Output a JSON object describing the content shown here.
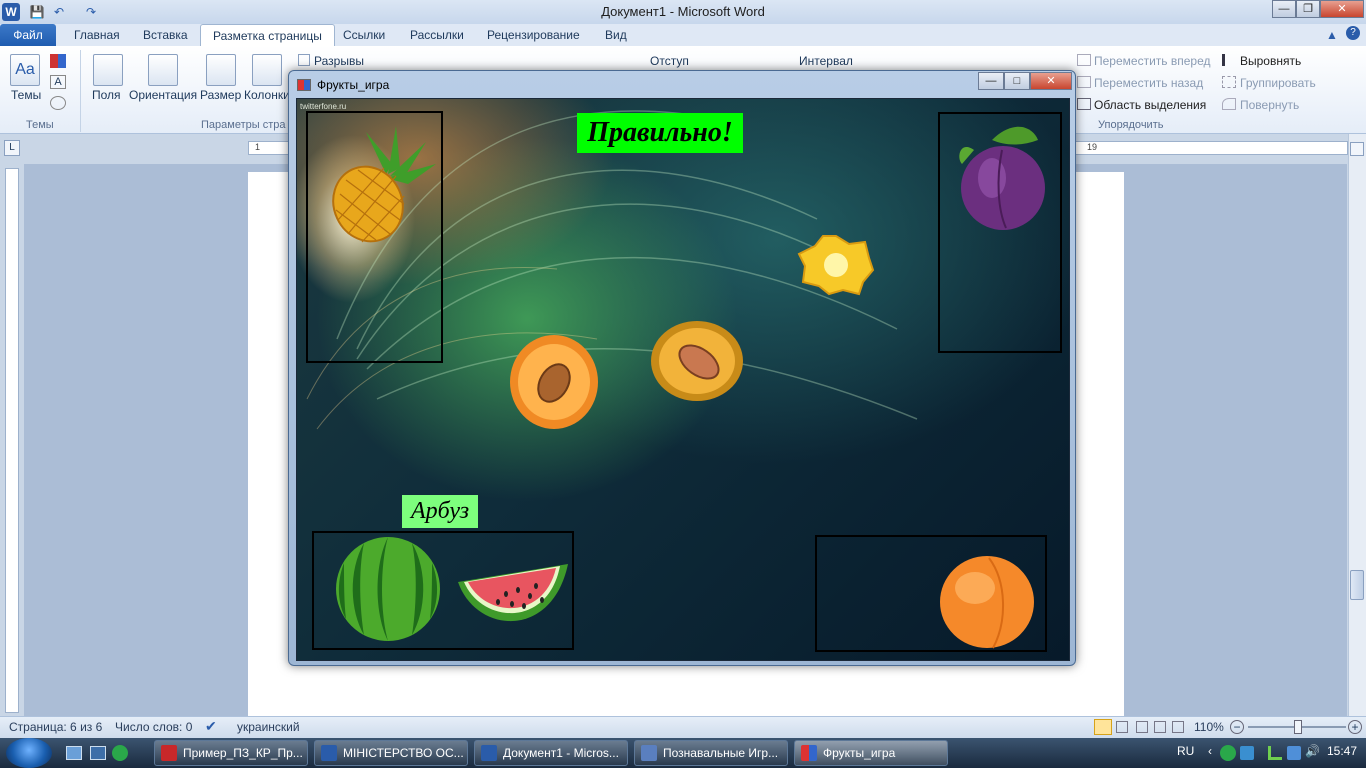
{
  "window": {
    "title": "Документ1  -  Microsoft Word"
  },
  "ribbon": {
    "file_tab": "Файл",
    "tabs": [
      "Главная",
      "Вставка",
      "Разметка страницы",
      "Ссылки",
      "Рассылки",
      "Рецензирование",
      "Вид"
    ],
    "active_tab": "Разметка страницы",
    "themes_label": "Темы",
    "themes_group": "Темы",
    "fields_label": "Поля",
    "orientation_label": "Ориентация",
    "size_label": "Размер",
    "columns_label": "Колонки",
    "breaks_label": "Разрывы",
    "page_setup_group": "Параметры стра",
    "indent_label": "Отступ",
    "spacing_label": "Интервал",
    "bring_forward": "Переместить вперед",
    "send_backward": "Переместить назад",
    "selection_pane": "Область выделения",
    "align": "Выровнять",
    "group": "Группировать",
    "rotate": "Повернуть",
    "arrange_group": "Упорядочить"
  },
  "ruler": {
    "h_marks": [
      "1",
      "19"
    ]
  },
  "game": {
    "title": "Фрукты_игра",
    "watermark": "twitterfone.ru",
    "status_message": "Правильно!",
    "current_fruit": "Арбуз",
    "colors": {
      "message_bg": "#00ff00",
      "label_bg": "#7dff7d"
    }
  },
  "statusbar": {
    "page": "Страница: 6 из 6",
    "words": "Число слов: 0",
    "language": "украинский",
    "zoom": "110%",
    "zoom_level_percent": 110
  },
  "taskbar": {
    "items": [
      "Пример_ПЗ_КР_Пр...",
      "МІНІСТЕРСТВО ОС...",
      "Документ1 - Micros...",
      "Познавальные Игр...",
      "Фрукты_игра"
    ],
    "active": "Фрукты_игра",
    "lang": "RU",
    "time": "15:47"
  }
}
